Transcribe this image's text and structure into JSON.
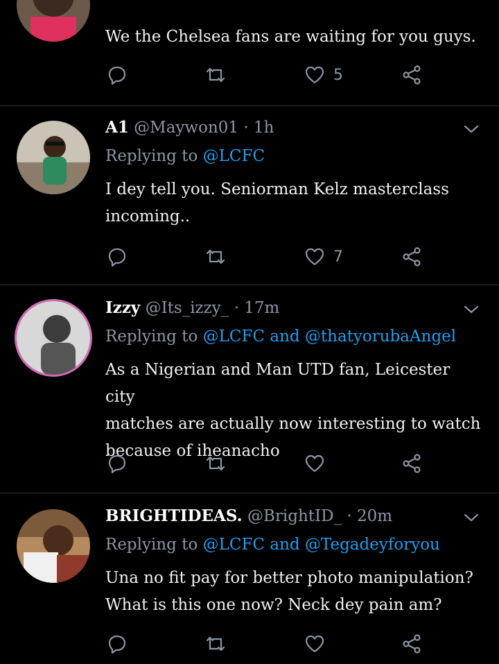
{
  "tweets": [
    {
      "text": "We the Chelsea fans are waiting for you guys.",
      "like_count": "5"
    },
    {
      "name": "A1",
      "handle": "@Maywon01",
      "time": "1h",
      "replying_prefix": "Replying to",
      "mentions": [
        "@LCFC"
      ],
      "text_lines": [
        "I dey tell you. Seniorman Kelz masterclass",
        "incoming.."
      ],
      "like_count": "7"
    },
    {
      "name": "Izzy",
      "handle": "@Its_izzy_",
      "time": "17m",
      "replying_prefix": "Replying to",
      "mentions": [
        "@LCFC",
        "@thatyorubaAngel"
      ],
      "conj": "and",
      "text_lines": [
        "As a Nigerian and Man UTD fan, Leicester city",
        "matches are actually now interesting to watch",
        "because of iheanacho"
      ],
      "like_count": ""
    },
    {
      "name": "BRIGHTIDEAS.",
      "handle": "@BrightID_",
      "time": "20m",
      "replying_prefix": "Replying to",
      "mentions": [
        "@LCFC",
        "@Tegadeyforyou"
      ],
      "conj": "and",
      "text_lines": [
        "Una no fit pay for better photo manipulation?",
        "What is this one now? Neck dey pain am?"
      ],
      "like_count": ""
    }
  ],
  "icons": {
    "reply": "reply-icon",
    "retweet": "retweet-icon",
    "like": "heart-icon",
    "share": "share-icon",
    "caret": "chevron-down-icon"
  },
  "colors": {
    "background": "#000000",
    "secondary_text": "#8b98a5",
    "mention": "#1da1f2",
    "divider": "#2f3336"
  },
  "sep": "·"
}
